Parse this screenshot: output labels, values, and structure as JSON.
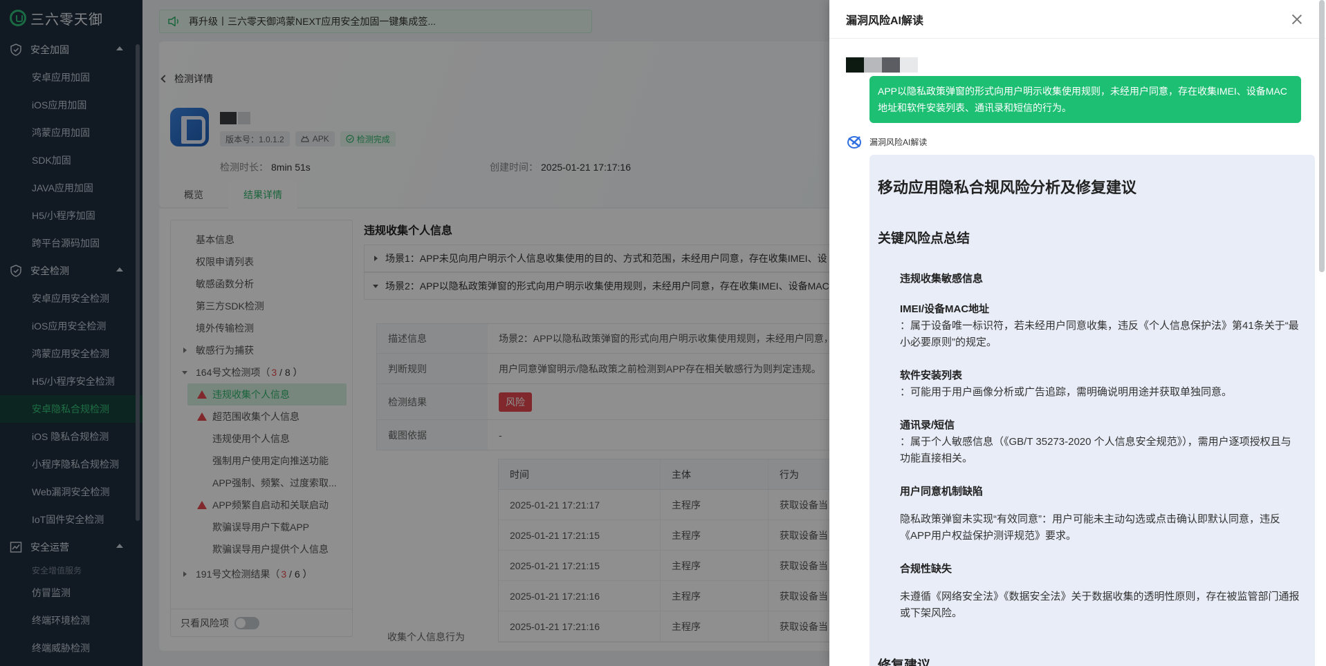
{
  "brand": "三六零天御",
  "sidebar": {
    "groups": [
      {
        "label": "安全加固",
        "icon": "shield-icon",
        "items": [
          "安卓应用加固",
          "iOS应用加固",
          "鸿蒙应用加固",
          "SDK加固",
          "JAVA应用加固",
          "H5/小程序加固",
          "跨平台源码加固"
        ]
      },
      {
        "label": "安全检测",
        "icon": "shield-check-icon",
        "items": [
          "安卓应用安全检测",
          "iOS应用安全检测",
          "鸿蒙应用安全检测",
          "H5/小程序安全检测",
          "安卓隐私合规检测",
          "iOS 隐私合规检测",
          "小程序隐私合规检测",
          "Web漏洞安全检测",
          "IoT固件安全检测"
        ]
      },
      {
        "label": "安全运营",
        "icon": "chart-icon",
        "note": "安全增值服务",
        "items": [
          "仿冒监测",
          "终端环境检测",
          "终端威胁检测"
        ]
      }
    ],
    "active_item": "安卓隐私合规检测"
  },
  "banner": "再升级丨三六零天御鸿蒙NEXT应用安全加固一键集成签...",
  "detail": {
    "back_label": "检测详情",
    "version_tag": "版本号：1.0.1.2",
    "type_tag": "APK",
    "status_tag": "检测完成",
    "duration_label": "检测时长：",
    "duration_value": "8min 51s",
    "created_label": "创建时间：",
    "created_value": "2025-01-21 17:17:16",
    "tabs": [
      "概览",
      "结果详情"
    ],
    "active_tab": "结果详情"
  },
  "tree": {
    "items": [
      "基本信息",
      "权限申请列表",
      "敏感函数分析",
      "第三方SDK检测",
      "境外传输检测",
      "敏感行为捕获"
    ],
    "group164": {
      "label": "164号文检测项（",
      "risk": "3",
      "total": "/ 8 ）"
    },
    "children164": [
      {
        "label": "违规收集个人信息",
        "warn": true
      },
      {
        "label": "超范围收集个人信息",
        "warn": true
      },
      {
        "label": "违规使用个人信息",
        "warn": false
      },
      {
        "label": "强制用户使用定向推送功能",
        "warn": false
      },
      {
        "label": "APP强制、频繁、过度索取...",
        "warn": false
      },
      {
        "label": "APP频繁自启动和关联启动",
        "warn": true
      },
      {
        "label": "欺骗误导用户下载APP",
        "warn": false
      },
      {
        "label": "欺骗误导用户提供个人信息",
        "warn": false
      }
    ],
    "group191": {
      "label": "191号文检测结果（",
      "risk": "3",
      "total": "/ 6 ）"
    },
    "only_risk_label": "只看风险项"
  },
  "panel": {
    "title": "违规收集个人信息",
    "scene1": "场景1：APP未见向用户明示个人信息收集使用的目的、方式和范围，未经用户同意，存在收集IMEI、设",
    "scene2": "场景2：APP以隐私政策弹窗的形式向用户明示收集使用规则，未经用户同意，存在收集IMEI、设备MAC",
    "desc_label": "描述信息",
    "desc_value": "场景2：APP以隐私政策弹窗的形式向用户明示收集使用规则，未经用户同意，",
    "rule_label": "判断规则",
    "rule_value": "用户同意弹窗明示/隐私政策之前检测到APP存在相关敏感行为则判定违规。",
    "result_label": "检测结果",
    "result_value": "风险",
    "evidence_label": "截图依据",
    "evidence_value": "-",
    "collect_label": "收集个人信息行为",
    "table_headers": [
      "时间",
      "主体",
      "行为"
    ],
    "table_rows": [
      [
        "2025-01-21 17:21:17",
        "主程序",
        "获取设备当"
      ],
      [
        "2025-01-21 17:21:15",
        "主程序",
        "获取设备当"
      ],
      [
        "2025-01-21 17:21:15",
        "主程序",
        "获取设备当"
      ],
      [
        "2025-01-21 17:21:16",
        "主程序",
        "获取设备当"
      ],
      [
        "2025-01-21 17:21:16",
        "主程序",
        "获取设备当"
      ]
    ]
  },
  "drawer": {
    "title": "漏洞风险AI解读",
    "user_message": "APP以隐私政策弹窗的形式向用户明示收集使用规则，未经用户同意，存在收集IMEI、设备MAC地址和软件安装列表、通讯录和短信的行为。",
    "ai_name": "漏洞风险AI解读",
    "h1": "移动应用隐私合规风险分析及修复建议",
    "section_key": "关键风险点总结",
    "sub_sensitive": "违规收集敏感信息",
    "imei_title": "IMEI/设备MAC地址",
    "imei_text": "：属于设备唯一标识符，若未经用户同意收集，违反《个人信息保护法》第41条关于“最小必要原则”的规定。",
    "apps_title": "软件安装列表",
    "apps_text": "：可能用于用户画像分析或广告追踪，需明确说明用途并获取单独同意。",
    "contacts_title": "通讯录/短信",
    "contacts_text": "：属于个人敏感信息（《GB/T 35273-2020 个人信息安全规范》），需用户逐项授权且与功能直接相关。",
    "consent_title": "用户同意机制缺陷",
    "consent_text": "隐私政策弹窗未实现“有效同意”：用户可能未主动勾选或点击确认即默认同意，违反《APP用户权益保护测评规范》要求。",
    "compliance_title": "合规性缺失",
    "compliance_text": "未遵循《网络安全法》《数据安全法》关于数据收集的透明性原则，存在被监管部门通报或下架风险。",
    "section_fix": "修复建议"
  },
  "colors": {
    "accent": "#1dbf73",
    "risk": "#e5484d",
    "sidebar_bg": "#1f2d3d",
    "ai_card_bg": "#e8edf7"
  }
}
